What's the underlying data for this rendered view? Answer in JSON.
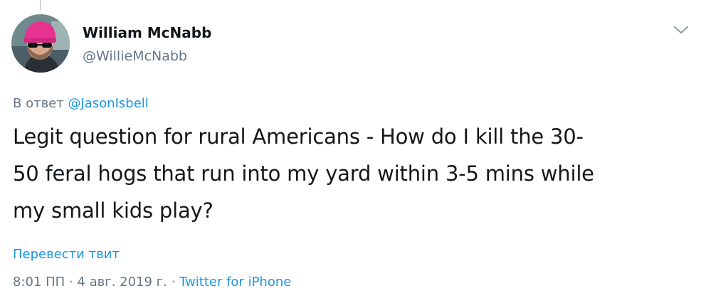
{
  "author": {
    "display_name": "William McNabb",
    "handle": "@WillieMcNabb",
    "avatar_icon": "profile-photo-pink-beanie-sunglasses"
  },
  "menu": {
    "icon": "chevron-down-icon"
  },
  "reply": {
    "prefix": "В ответ",
    "mention": "@JasonIsbell"
  },
  "tweet": {
    "lines": [
      "Legit question for rural Americans - How do I kill the 30-",
      "50 feral hogs that run into my yard within 3-5 mins while",
      "my small kids play?"
    ]
  },
  "translate": {
    "label": "Перевести твит"
  },
  "meta": {
    "time": "8:01 ПП",
    "separator": "·",
    "date": "4 авг. 2019 г.",
    "source": "Twitter for iPhone"
  },
  "colors": {
    "link": "#1b95e0",
    "secondary_text": "#657786",
    "primary_text": "#14171a",
    "beanie": "#e5338f"
  }
}
